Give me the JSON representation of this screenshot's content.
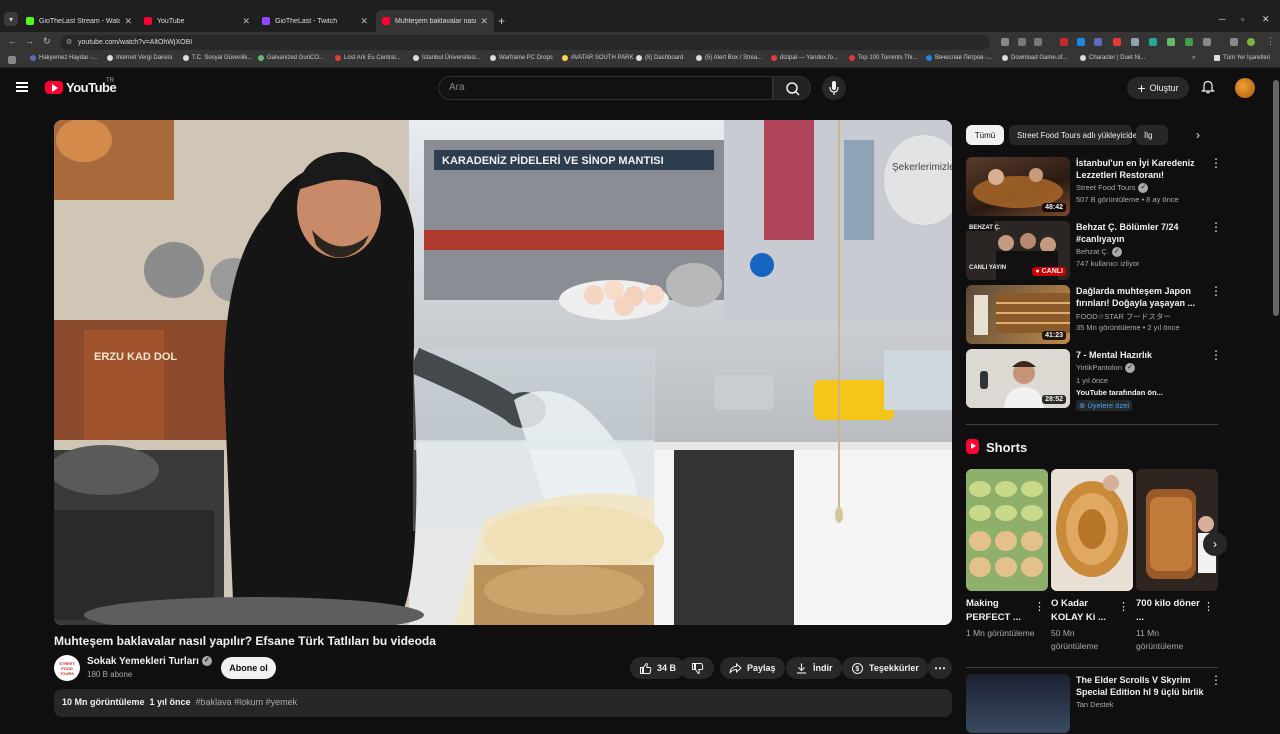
{
  "browser": {
    "tabs": [
      {
        "title": "GioTheLast Stream - Watch Live",
        "color": "#53fc18"
      },
      {
        "title": "YouTube",
        "color": "#ff0033"
      },
      {
        "title": "GioTheLast - Twitch",
        "color": "#9146ff"
      },
      {
        "title": "Muhteşem baklavalar nasıl",
        "color": "#ff0033"
      }
    ],
    "url": "youtube.com/watch?v=AltOhWjXOBI",
    "bookmarks": [
      "Hakyemez Haydar -...",
      "Internet Vergi Dairesi",
      "T.C. Sosyal Güvenlik...",
      "Galvanized GunCO...",
      "Lost Ark Eu Central...",
      "İstanbul Üniversitesi...",
      "Warframe PC Drops",
      "AVATAR SOUTH PARK",
      "(8) Dashboard",
      "(5) Alert Box / Strea...",
      "dizipal — Yandex.fo...",
      "Top 100 Torrents Thi...",
      "Вячеслав Петров -...",
      "Download Game.of...",
      "Character | Duet Ni..."
    ],
    "all_bookmarks": "Tüm Yer İşaretleri"
  },
  "header": {
    "logo_text": "YouTube",
    "country_code": "TR",
    "search_placeholder": "Ara",
    "create_label": "Oluştur"
  },
  "video": {
    "title": "Muhteşem baklavalar nasıl yapılır? Efsane Türk Tatlıları bu videoda",
    "channel": "Sokak Yemekleri Turları",
    "channel_avatar_text": "STREET FOOD TOURS",
    "subscribers": "180 B abone",
    "subscribe_label": "Abone ol",
    "likes": "34 B",
    "share_label": "Paylaş",
    "download_label": "İndir",
    "thanks_label": "Teşekkürler",
    "views": "10 Mn görüntüleme",
    "age": "1 yıl önce",
    "tags": "#baklava #lokum #yemek",
    "scene_text": {
      "sign": "KARADENİZ PİDELERİ VE SİNOP MANTISI",
      "window": "Şekerlerimizle Kaç Şeker Yoktur",
      "box": "ERZU KAD DOL"
    }
  },
  "chips": [
    "Tümü",
    "Street Food Tours adlı yükleyiciden",
    "İlg"
  ],
  "recommendations": [
    {
      "title": "İstanbul'un en İyi Karedeniz Lezzetleri Restoranı!",
      "channel": "Street Food Tours",
      "verified": true,
      "meta": "507 B görüntüleme • 8 ay önce",
      "duration": "48:42"
    },
    {
      "title": "Behzat Ç. Bölümler 7/24 #canlıyayın",
      "channel": "Behzat Ç.",
      "verified": true,
      "meta": "747 kullanıcı izliyor",
      "live": "CANLI",
      "thumb_label": "BEHZAT Ç.",
      "thumb_live": "CANLI YAYIN"
    },
    {
      "title": "Dağlarda muhteşem Japon fırınları! Doğayla yaşayan ...",
      "channel": "FOOD☆STAR フードスター",
      "verified": false,
      "meta": "35 Mn görüntüleme • 2 yıl önce",
      "duration": "41:23"
    },
    {
      "title": "7 - Mental Hazırlık",
      "channel": "YirtikPantolon",
      "verified": true,
      "meta": "1 yıl önce",
      "meta2": "YouTube tarafından ön...",
      "members": "Üyelere özel",
      "duration": "28:52"
    }
  ],
  "shorts": {
    "heading": "Shorts",
    "items": [
      {
        "title": "Making PERFECT ...",
        "views": "1 Mn görüntüleme"
      },
      {
        "title": "O Kadar KOLAY Ki ...",
        "views": "50 Mn görüntüleme"
      },
      {
        "title": "700 kilo döner ...",
        "views": "11 Mn görüntüleme"
      }
    ]
  },
  "next_rec": {
    "title": "The Elder Scrolls V Skyrim Special Edition hl 9 üçlü birlik",
    "channel": "Tan Destek"
  }
}
